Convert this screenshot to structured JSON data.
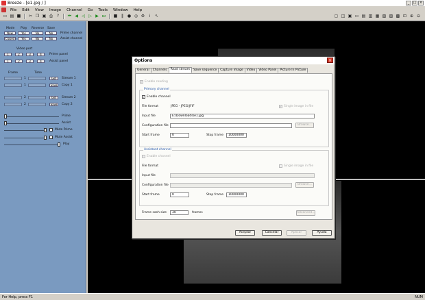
{
  "window": {
    "title": "Breeze - [e1.jpg  /  ]",
    "buttons": {
      "minimize": "_",
      "maximize": "□",
      "close": "×"
    }
  },
  "menu": [
    "File",
    "Edit",
    "View",
    "Image",
    "Channel",
    "Go",
    "Tools",
    "Window",
    "Help"
  ],
  "left_panel": {
    "headers": {
      "mode": "Mode",
      "play": "Play",
      "reverse": "Reverse",
      "save": "Save"
    },
    "row1": {
      "mode": "New",
      "play": "Yes",
      "reverse": "No",
      "save": "No",
      "label": "Prime channel"
    },
    "row2": {
      "mode": "Closed",
      "play": "Yes",
      "reverse": "No",
      "save": "No",
      "label": "Assist channel"
    },
    "video_port": "Video port",
    "prime_panel": "Prime panel",
    "assist_panel": "Assist panel",
    "port_buttons_row1": [
      "1",
      "2",
      "3",
      "4"
    ],
    "port_buttons_row2": [
      "1",
      "2",
      "3",
      "4"
    ],
    "frame_header": "Frame",
    "time_header": "Time",
    "slots": [
      {
        "num": "1",
        "button": "Get",
        "label": "Stream 1"
      },
      {
        "num": "1",
        "button": "Save",
        "label": "Copy 1"
      },
      {
        "num": "2",
        "button": "Get",
        "label": "Stream 2"
      },
      {
        "num": "2",
        "button": "Save",
        "label": "Copy 2"
      }
    ],
    "sliders": [
      "Prime",
      "Assist"
    ],
    "mute_prime": "Mute Prime",
    "mute_assist": "Mute Assist",
    "play_label": "Play"
  },
  "dialog": {
    "title": "Options",
    "close": "×",
    "tabs": [
      "General",
      "Channels",
      "Read stream",
      "Save sequence",
      "Capture image",
      "Video",
      "Video Panel",
      "Picture In Picture"
    ],
    "active_tab": "Read stream",
    "enable_reading": "Enable reading",
    "primary": {
      "title": "Primary channel",
      "enable_channel": "Enable channel",
      "file_format_label": "File format",
      "file_format_value": "JPEG - JPEG/JFIF",
      "single_image": "Single image in file",
      "input_file_label": "Input file",
      "input_file_value": "E:\\Downloads\\e1.jpg",
      "config_file_label": "Configuration file",
      "browse": "Browse...",
      "start_frame_label": "Start frame",
      "start_frame_value": "0",
      "stop_frame_label": "Stop frame",
      "stop_frame_value": "10000000"
    },
    "assistant": {
      "title": "Assistant channel",
      "enable_channel": "Enable channel",
      "file_format_label": "File format",
      "single_image": "Single image in file",
      "input_file_label": "Input file",
      "config_file_label": "Configuration file",
      "browse": "Browse...",
      "start_frame_label": "Start frame",
      "start_frame_value": "0",
      "stop_frame_label": "Stop frame",
      "stop_frame_value": "10000000"
    },
    "frame_cash_label": "Frame cash size",
    "frame_cash_value": "30",
    "frames_unit": "frames",
    "advanced": "Advanced...",
    "buttons": {
      "accept": "Aceptar",
      "cancel": "Cancelar",
      "apply": "Aplicar",
      "help": "Ayuda"
    }
  },
  "status": {
    "left": "For Help, press F1",
    "right": "NUM"
  }
}
